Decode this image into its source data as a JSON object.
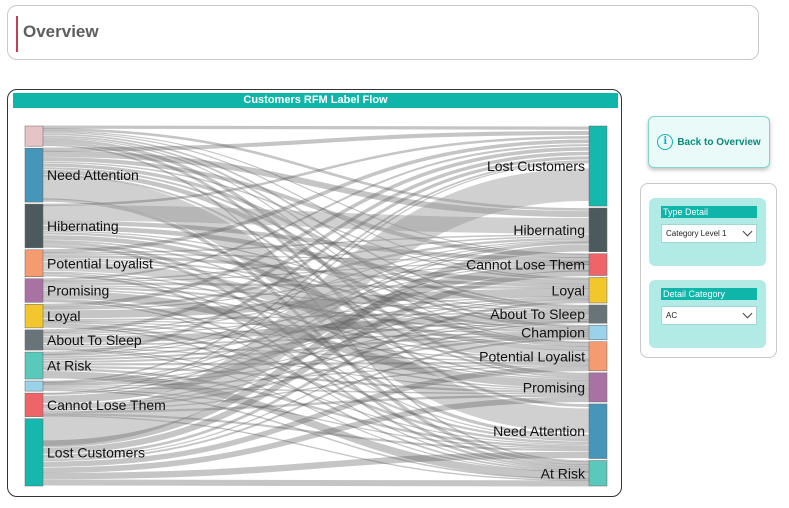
{
  "header": {
    "title": "Overview"
  },
  "chart": {
    "title": "Customers RFM Label Flow"
  },
  "chart_data": {
    "type": "sankey",
    "title": "Customers RFM Label Flow",
    "left_nodes": [
      {
        "name": "",
        "color": "#e5c3c6",
        "value": 6
      },
      {
        "name": "Need Attention",
        "color": "#4596b8",
        "value": 16
      },
      {
        "name": "Hibernating",
        "color": "#4c5a5e",
        "value": 13
      },
      {
        "name": "Potential Loyalist",
        "color": "#f49b70",
        "value": 8
      },
      {
        "name": "Promising",
        "color": "#a872a2",
        "value": 7
      },
      {
        "name": "Loyal",
        "color": "#f2c72d",
        "value": 7
      },
      {
        "name": "About To Sleep",
        "color": "#697479",
        "value": 6
      },
      {
        "name": "At Risk",
        "color": "#59c9bc",
        "value": 8
      },
      {
        "name": "",
        "color": "#9ad2ea",
        "value": 3
      },
      {
        "name": "Cannot Lose Them",
        "color": "#ef6468",
        "value": 7
      },
      {
        "name": "Lost Customers",
        "color": "#14b8ad",
        "value": 20
      }
    ],
    "right_nodes": [
      {
        "name": "Lost Customers",
        "color": "#14b8ad",
        "value": 22
      },
      {
        "name": "Hibernating",
        "color": "#4c5a5e",
        "value": 12
      },
      {
        "name": "Cannot Lose Them",
        "color": "#ef6468",
        "value": 6
      },
      {
        "name": "Loyal",
        "color": "#f2c72d",
        "value": 7
      },
      {
        "name": "About To Sleep",
        "color": "#697479",
        "value": 5
      },
      {
        "name": "Champion",
        "color": "#9ad2ea",
        "value": 4
      },
      {
        "name": "Potential Loyalist",
        "color": "#f49b70",
        "value": 8
      },
      {
        "name": "Promising",
        "color": "#a872a2",
        "value": 8
      },
      {
        "name": "Need Attention",
        "color": "#4596b8",
        "value": 15
      },
      {
        "name": "At Risk",
        "color": "#59c9bc",
        "value": 7
      }
    ],
    "flow_seed": 7
  },
  "back_button": {
    "label": "Back to Overview",
    "icon": "info-icon"
  },
  "filters": [
    {
      "label": "Type Detail",
      "value": "Category Level 1"
    },
    {
      "label": "Detail Category",
      "value": "AC"
    }
  ]
}
